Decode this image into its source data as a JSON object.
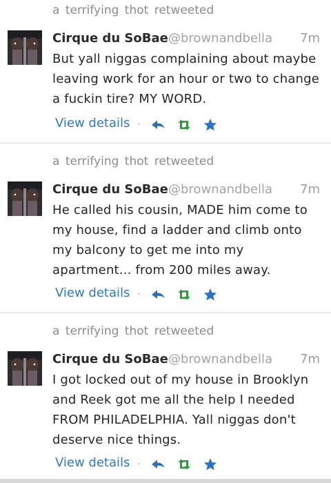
{
  "colors": {
    "link": "#2f7bbf",
    "reply_icon": "#2f6fb5",
    "retweet_icon": "#2e9a3a",
    "favorite_icon": "#2a72c4",
    "muted_text": "#8c8c8c"
  },
  "icons": {
    "reply": "reply-arrow-icon",
    "retweet": "retweet-icon",
    "favorite": "star-icon"
  },
  "tweets": [
    {
      "retweeted_by": "a terrifying thot retweeted",
      "name": "Cirque du SoBae",
      "handle": "@brownandbella",
      "time": "7m",
      "text": "But yall niggas complaining about maybe leaving work for an hour or two to change a fuckin tire? MY WORD.",
      "view_details": "View details",
      "separator": "·"
    },
    {
      "retweeted_by": "a terrifying thot retweeted",
      "name": "Cirque du SoBae",
      "handle": "@brownandbella",
      "time": "7m",
      "text": "He called his cousin, MADE him come to my house, find a ladder and climb onto my balcony to get me into my apartment... from 200 miles away.",
      "view_details": "View details",
      "separator": "·"
    },
    {
      "retweeted_by": "a terrifying thot retweeted",
      "name": "Cirque du SoBae",
      "handle": "@brownandbella",
      "time": "7m",
      "text": "I got locked out of my house in Brooklyn and Reek got me all the help I needed FROM PHILADELPHIA.  Yall niggas don't deserve nice things.",
      "view_details": "View details",
      "separator": "·"
    }
  ]
}
